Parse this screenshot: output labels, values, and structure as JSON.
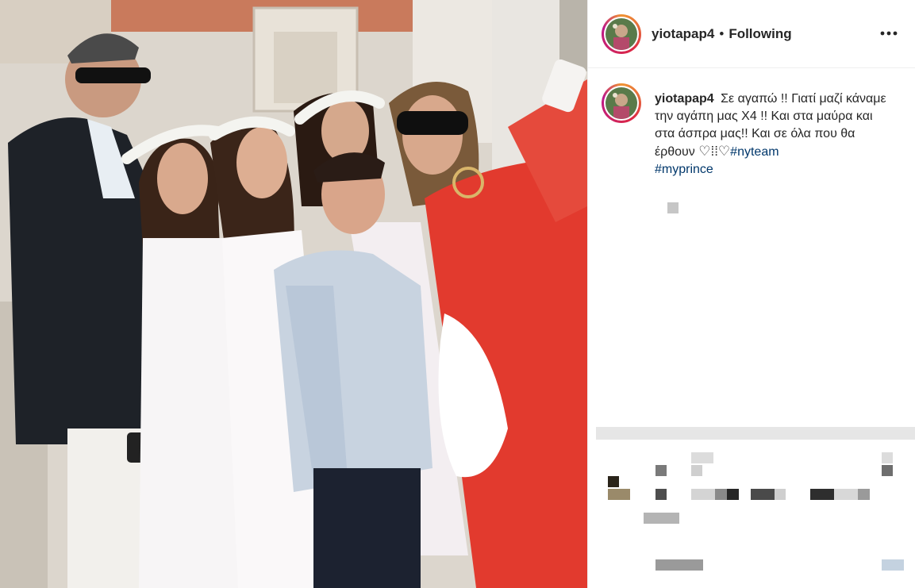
{
  "post": {
    "username": "yiotapap4",
    "separator": "•",
    "follow_state": "Following",
    "more_icon": "more-horizontal-icon",
    "caption": {
      "user": "yiotapap4",
      "text": "Σε αγαπώ !! Γιατί μαζί κάναμε την αγάπη μας Χ4 !! Και στα μαύρα και στα άσπρα μας!! Και σε όλα που θα έρθουν",
      "hearts": "♡⁞⁞♡",
      "tags": [
        "#nyteam",
        "#myprince"
      ]
    }
  },
  "colors": {
    "link": "#00376b",
    "text": "#262626",
    "dress_red": "#e23a2e",
    "border": "#efefef"
  }
}
